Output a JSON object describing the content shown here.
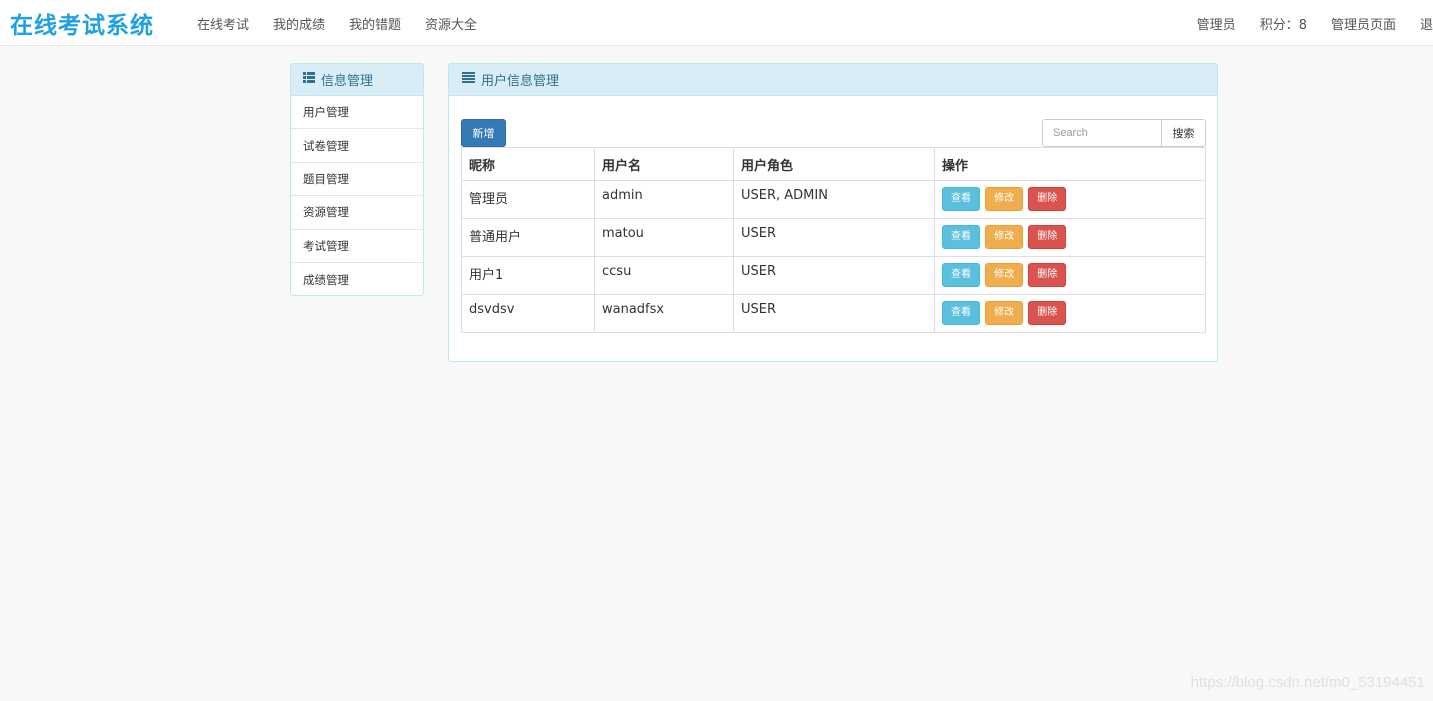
{
  "navbar": {
    "brand": "在线考试系统",
    "links": [
      "在线考试",
      "我的成绩",
      "我的错题",
      "资源大全"
    ],
    "right": {
      "role": "管理员",
      "points": "积分：8",
      "admin_page": "管理员页面",
      "cut_off": "退"
    }
  },
  "sidebar": {
    "title": "信息管理",
    "items": [
      {
        "label": "用户管理"
      },
      {
        "label": "试卷管理"
      },
      {
        "label": "题目管理"
      },
      {
        "label": "资源管理"
      },
      {
        "label": "考试管理"
      },
      {
        "label": "成绩管理"
      }
    ]
  },
  "main": {
    "title": "用户信息管理",
    "add_label": "新增",
    "search": {
      "placeholder": "Search",
      "button": "搜索"
    },
    "columns": [
      "昵称",
      "用户名",
      "用户角色",
      "操作"
    ],
    "rows": [
      {
        "nickname": "管理员",
        "username": "admin",
        "roles": "USER, ADMIN"
      },
      {
        "nickname": "普通用户",
        "username": "matou",
        "roles": "USER"
      },
      {
        "nickname": "用户1",
        "username": "ccsu",
        "roles": "USER"
      },
      {
        "nickname": "dsvdsv",
        "username": "wanadfsx",
        "roles": "USER"
      }
    ],
    "actions": {
      "view": "查看",
      "edit": "修改",
      "delete": "删除"
    }
  },
  "watermark": "https://blog.csdn.net/m0_53194451"
}
